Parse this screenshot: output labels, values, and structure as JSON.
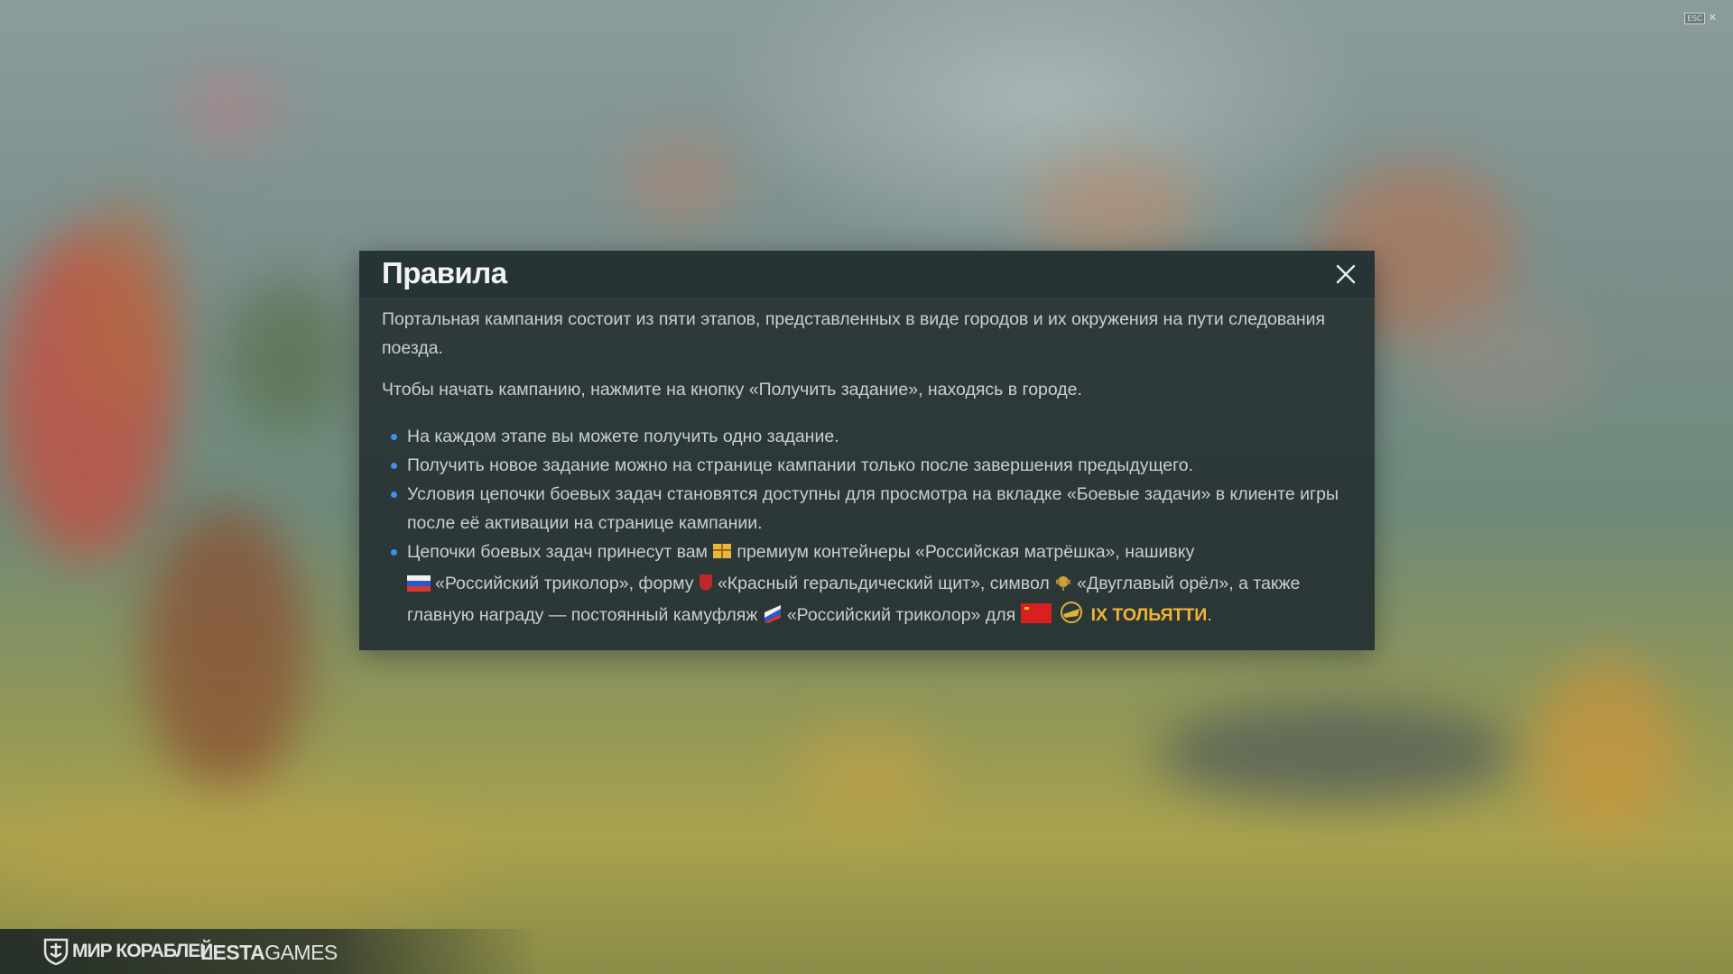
{
  "overlay": {
    "esc_key": "ESC",
    "esc_close": "✕"
  },
  "modal": {
    "title": "Правила",
    "intro": "Портальная кампания состоит из пяти этапов, представленных в виде городов и их окружения на пути следования поезда.",
    "instruction": "Чтобы начать кампанию, нажмите на кнопку «Получить задание», находясь в городе.",
    "rules": [
      "На каждом этапе вы можете получить одно задание.",
      "Получить новое задание можно на странице кампании только после завершения предыдущего.",
      "Условия цепочки боевых задач становятся доступны для просмотра на вкладке «Боевые задачи» в клиенте игры после её активации на странице кампании."
    ],
    "reward": {
      "t1": "Цепочки боевых задач принесут вам",
      "t2": "премиум контейнеры «Российская матрёшка», нашивку",
      "t3": "«Российский триколор», форму",
      "t4": "«Красный геральдический щит», символ",
      "t5": "«Двуглавый орёл», а также главную награду — постоянный камуфляж",
      "t6": "«Российский триколор» для",
      "ship": "IX ТОЛЬЯТТИ",
      "end": "."
    }
  },
  "footer": {
    "brand": "МИР КОРАБЛЕЙ",
    "publisher_bold": "LESTA",
    "publisher_light": "GAMES"
  },
  "icons": [
    "container-icon",
    "tricolor-patch-icon",
    "red-shield-icon",
    "eagle-icon",
    "camo-icon",
    "ussr-flag-icon",
    "tier-icon",
    "close-icon",
    "ship-logo-icon"
  ]
}
